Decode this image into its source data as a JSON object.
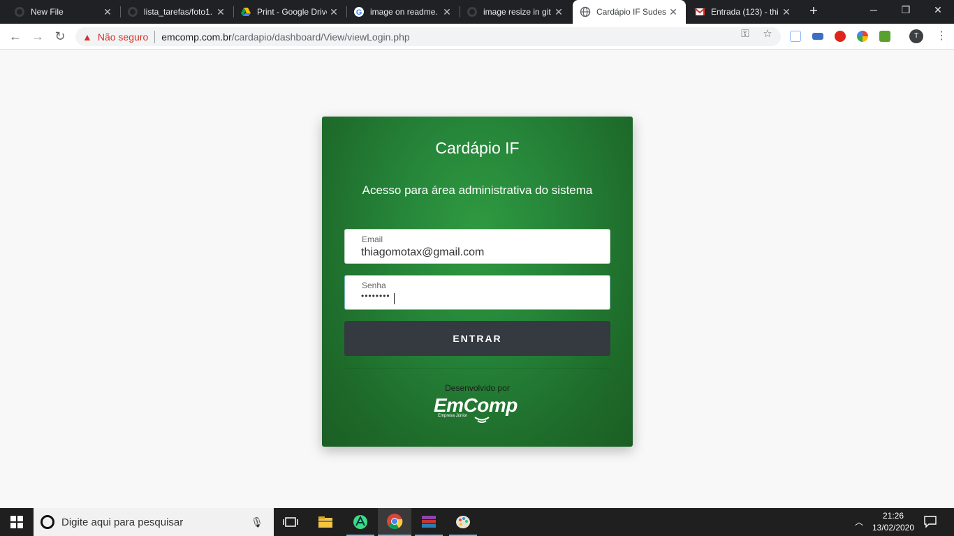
{
  "browser": {
    "tabs": [
      {
        "title": "New File",
        "icon": "github-icon",
        "active": false
      },
      {
        "title": "lista_tarefas/foto1.",
        "icon": "github-icon",
        "active": false
      },
      {
        "title": "Print - Google Drive",
        "icon": "google-drive-icon",
        "active": false
      },
      {
        "title": "image on readme.",
        "icon": "google-icon",
        "active": false
      },
      {
        "title": "image resize in git",
        "icon": "github-icon",
        "active": false
      },
      {
        "title": "Cardápio IF Sudest",
        "icon": "globe-icon",
        "active": true
      },
      {
        "title": "Entrada (123) - thi",
        "icon": "gmail-icon",
        "active": false
      }
    ],
    "security_label": "Não seguro",
    "url_host": "emcomp.com.br",
    "url_path": "/cardapio/dashboard/View/viewLogin.php",
    "profile_initial": "T"
  },
  "login": {
    "title": "Cardápio IF",
    "subtitle": "Acesso para área administrativa do sistema",
    "email_label": "Email",
    "email_value": "thiagomotax@gmail.com",
    "password_label": "Senha",
    "password_value": "••••••••",
    "submit_label": "ENTRAR",
    "developed_by": "Desenvolvido por",
    "logo_text": "EmComp",
    "logo_subtext": "Empresa Júnior"
  },
  "taskbar": {
    "search_placeholder": "Digite aqui para pesquisar",
    "time": "21:26",
    "date": "13/02/2020"
  },
  "colors": {
    "card_green": "#26863a",
    "button_dark": "#343a40",
    "insecure_red": "#d93025",
    "tabstrip": "#202124"
  }
}
